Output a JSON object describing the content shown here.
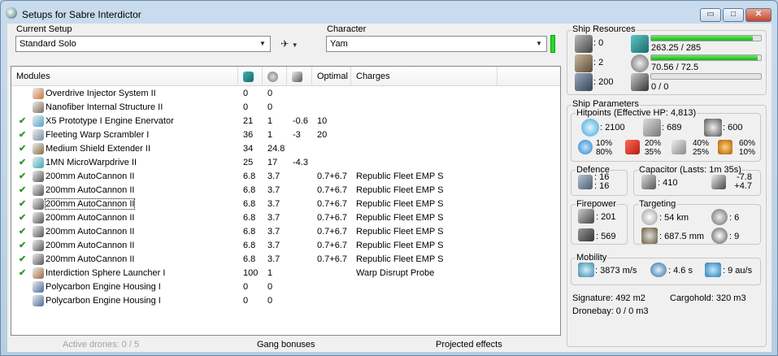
{
  "window": {
    "title": "Setups for Sabre Interdictor",
    "min_icon": "minimize-icon",
    "max_icon": "maximize-icon",
    "close_icon": "close-icon",
    "min_glyph": "▭",
    "max_glyph": "□",
    "close_glyph": "✕"
  },
  "setup": {
    "label": "Current Setup",
    "value": "Standard Solo"
  },
  "character": {
    "label": "Character",
    "value": "Yam"
  },
  "columns": {
    "modules": "Modules",
    "optimal": "Optimal",
    "charges": "Charges"
  },
  "column_icons": [
    "cpu-icon",
    "powergrid-icon",
    "capacitor-icon"
  ],
  "modules": [
    {
      "checked": false,
      "name": "Overdrive Injector System II",
      "cpu": "0",
      "pg": "0",
      "cap": "",
      "optimal": "",
      "charges": "",
      "icon": "overdrive-injector-icon",
      "color": "#c9773a"
    },
    {
      "checked": false,
      "name": "Nanofiber Internal Structure II",
      "cpu": "0",
      "pg": "0",
      "cap": "",
      "optimal": "",
      "charges": "",
      "icon": "nanofiber-icon",
      "color": "#7a6b5a"
    },
    {
      "checked": true,
      "name": "X5 Prototype I Engine Enervator",
      "cpu": "21",
      "pg": "1",
      "cap": "-0.6",
      "optimal": "10",
      "charges": "",
      "icon": "webifier-icon",
      "color": "#4fa3c9"
    },
    {
      "checked": true,
      "name": "Fleeting Warp Scrambler I",
      "cpu": "36",
      "pg": "1",
      "cap": "-3",
      "optimal": "20",
      "charges": "",
      "icon": "warp-scrambler-icon",
      "color": "#7c8fa3"
    },
    {
      "checked": true,
      "name": "Medium Shield Extender II",
      "cpu": "34",
      "pg": "24.8",
      "cap": "",
      "optimal": "",
      "charges": "",
      "icon": "shield-extender-icon",
      "color": "#8a6a3e"
    },
    {
      "checked": true,
      "name": "1MN MicroWarpdrive II",
      "cpu": "25",
      "pg": "17",
      "cap": "-4.3",
      "optimal": "",
      "charges": "",
      "icon": "microwarpdrive-icon",
      "color": "#3aa7b8"
    },
    {
      "checked": true,
      "name": "200mm AutoCannon II",
      "cpu": "6.8",
      "pg": "3.7",
      "cap": "",
      "optimal": "0.7+6.7",
      "charges": "Republic Fleet EMP S",
      "icon": "autocannon-icon",
      "color": "#555"
    },
    {
      "checked": true,
      "name": "200mm AutoCannon II",
      "cpu": "6.8",
      "pg": "3.7",
      "cap": "",
      "optimal": "0.7+6.7",
      "charges": "Republic Fleet EMP S",
      "icon": "autocannon-icon",
      "color": "#555"
    },
    {
      "checked": true,
      "name": "200mm AutoCannon II",
      "cpu": "6.8",
      "pg": "3.7",
      "cap": "",
      "optimal": "0.7+6.7",
      "charges": "Republic Fleet EMP S",
      "icon": "autocannon-icon",
      "color": "#555",
      "selected": true
    },
    {
      "checked": true,
      "name": "200mm AutoCannon II",
      "cpu": "6.8",
      "pg": "3.7",
      "cap": "",
      "optimal": "0.7+6.7",
      "charges": "Republic Fleet EMP S",
      "icon": "autocannon-icon",
      "color": "#555"
    },
    {
      "checked": true,
      "name": "200mm AutoCannon II",
      "cpu": "6.8",
      "pg": "3.7",
      "cap": "",
      "optimal": "0.7+6.7",
      "charges": "Republic Fleet EMP S",
      "icon": "autocannon-icon",
      "color": "#555"
    },
    {
      "checked": true,
      "name": "200mm AutoCannon II",
      "cpu": "6.8",
      "pg": "3.7",
      "cap": "",
      "optimal": "0.7+6.7",
      "charges": "Republic Fleet EMP S",
      "icon": "autocannon-icon",
      "color": "#555"
    },
    {
      "checked": true,
      "name": "200mm AutoCannon II",
      "cpu": "6.8",
      "pg": "3.7",
      "cap": "",
      "optimal": "0.7+6.7",
      "charges": "Republic Fleet EMP S",
      "icon": "autocannon-icon",
      "color": "#555"
    },
    {
      "checked": true,
      "name": "Interdiction Sphere Launcher I",
      "cpu": "100",
      "pg": "1",
      "cap": "",
      "optimal": "",
      "charges": "Warp Disrupt Probe",
      "icon": "launcher-icon",
      "color": "#9a6a3a"
    },
    {
      "checked": false,
      "name": "Polycarbon Engine Housing I",
      "cpu": "0",
      "pg": "0",
      "cap": "",
      "optimal": "",
      "charges": "",
      "icon": "rig-icon",
      "color": "#4a6a9a"
    },
    {
      "checked": false,
      "name": "Polycarbon Engine Housing I",
      "cpu": "0",
      "pg": "0",
      "cap": "",
      "optimal": "",
      "charges": "",
      "icon": "rig-icon",
      "color": "#4a6a9a"
    }
  ],
  "bottom": {
    "drones": "Active drones: 0 / 5",
    "gang": "Gang bonuses",
    "projected": "Projected effects"
  },
  "resources": {
    "label": "Ship Resources",
    "hardpoints": [
      {
        "icon": "turret-hardpoint-icon",
        "value": ": 0"
      },
      {
        "icon": "launcher-hardpoint-icon",
        "value": ": 2"
      },
      {
        "icon": "calibration-icon",
        "value": ": 200"
      }
    ],
    "bars": [
      {
        "icon": "cpu-icon",
        "text": "263.25 / 285",
        "fraction": 0.924
      },
      {
        "icon": "powergrid-icon",
        "text": "70.56 / 72.5",
        "fraction": 0.973
      },
      {
        "icon": "drone-bandwidth-icon",
        "text": "0 / 0",
        "fraction": 0
      }
    ]
  },
  "params": {
    "label": "Ship Parameters",
    "hitpoints_label": "Hitpoints (Effective HP: 4,813)",
    "hp": [
      {
        "icon": "shield-hp-icon",
        "value": ": 2100"
      },
      {
        "icon": "armor-hp-icon",
        "value": ": 689"
      },
      {
        "icon": "structure-hp-icon",
        "value": ": 600"
      }
    ],
    "resists": [
      {
        "icon": "em-resist-icon",
        "top": "10%",
        "bottom": "80%"
      },
      {
        "icon": "thermal-resist-icon",
        "top": "20%",
        "bottom": "35%"
      },
      {
        "icon": "kinetic-resist-icon",
        "top": "40%",
        "bottom": "25%"
      },
      {
        "icon": "explosive-resist-icon",
        "top": "60%",
        "bottom": "10%"
      }
    ],
    "defence": {
      "label": "Defence",
      "a": ": 16",
      "b": ": 16",
      "icon": "defence-icon"
    },
    "capacitor": {
      "label": "Capacitor (Lasts: 1m 35s)",
      "value": ": 410",
      "delta_top": "-7.8",
      "delta_bottom": "+4.7",
      "icon": "capacitor-icon",
      "icon2": "cap-recharge-icon"
    },
    "firepower": {
      "label": "Firepower",
      "a": ": 201",
      "b": ": 569",
      "icon_a": "turret-dps-icon",
      "icon_b": "volley-icon"
    },
    "targeting": {
      "label": "Targeting",
      "range": ": 54 km",
      "targets": ": 6",
      "scan_res": ": 687.5 mm",
      "sensor": ": 9",
      "icon_range": "target-range-icon",
      "icon_targets": "max-targets-icon",
      "icon_scan": "scan-resolution-icon",
      "icon_sensor": "sensor-strength-icon"
    },
    "mobility": {
      "label": "Mobility",
      "speed": ": 3873 m/s",
      "align": ": 4.6 s",
      "warp": ": 9 au/s",
      "icon_speed": "velocity-icon",
      "icon_align": "align-time-icon",
      "icon_warp": "warp-speed-icon"
    },
    "signature": "Signature: 492 m2",
    "cargohold": "Cargohold: 320 m3",
    "dronebay": "Dronebay: 0 / 0 m3"
  },
  "colors": {
    "bar_green": "#22cc22",
    "check_green": "#2a9a2a",
    "titlebar": "#bcd3ea"
  }
}
